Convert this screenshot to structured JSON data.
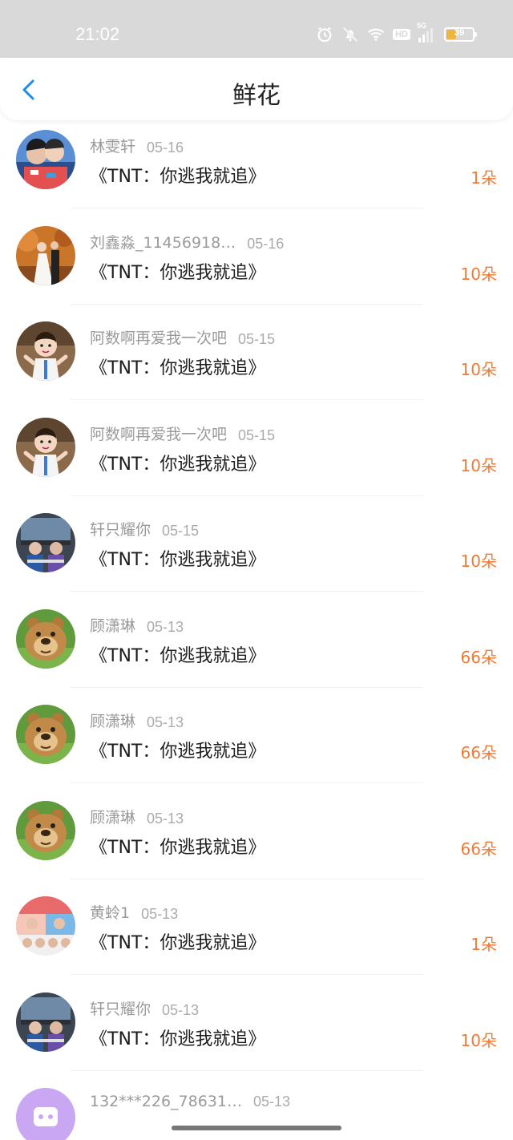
{
  "status_bar": {
    "time": "21:02",
    "network": "5G",
    "hd": "HD",
    "battery": "39",
    "battery_level": 0.39,
    "icons": [
      "alarm-icon",
      "mute-icon",
      "wifi-icon",
      "hd-icon",
      "signal-icon",
      "battery-icon"
    ]
  },
  "header": {
    "title": "鲜花",
    "back_icon": "chevron-left-icon",
    "accent": "#1a8cf0"
  },
  "colors": {
    "amount": "#f07a33",
    "name": "#9a9a9a",
    "book": "#1d1d1d"
  },
  "items": [
    {
      "name": "林雯轩",
      "date": "05-16",
      "book": "《TNT：你逃我就追》",
      "amount": "1朵",
      "avatar": "couple-photo"
    },
    {
      "name": "刘鑫淼_11456918…",
      "date": "05-16",
      "book": "《TNT：你逃我就追》",
      "amount": "10朵",
      "avatar": "wedding-photo"
    },
    {
      "name": "阿数啊再爱我一次吧",
      "date": "05-15",
      "book": "《TNT：你逃我就追》",
      "amount": "10朵",
      "avatar": "baby-photo"
    },
    {
      "name": "阿数啊再爱我一次吧",
      "date": "05-15",
      "book": "《TNT：你逃我就追》",
      "amount": "10朵",
      "avatar": "baby-photo"
    },
    {
      "name": "轩只耀你",
      "date": "05-15",
      "book": "《TNT：你逃我就追》",
      "amount": "10朵",
      "avatar": "group-photo"
    },
    {
      "name": "顾潇琳",
      "date": "05-13",
      "book": "《TNT：你逃我就追》",
      "amount": "66朵",
      "avatar": "bear-cartoon"
    },
    {
      "name": "顾潇琳",
      "date": "05-13",
      "book": "《TNT：你逃我就追》",
      "amount": "66朵",
      "avatar": "bear-cartoon"
    },
    {
      "name": "顾潇琳",
      "date": "05-13",
      "book": "《TNT：你逃我就追》",
      "amount": "66朵",
      "avatar": "bear-cartoon"
    },
    {
      "name": "黄蛉1",
      "date": "05-13",
      "book": "《TNT：你逃我就追》",
      "amount": "1朵",
      "avatar": "collage-photo"
    },
    {
      "name": "轩只耀你",
      "date": "05-13",
      "book": "《TNT：你逃我就追》",
      "amount": "10朵",
      "avatar": "group-photo"
    },
    {
      "name": "132***226_78631…",
      "date": "05-13",
      "book": "",
      "amount": "",
      "avatar": "purple-default"
    }
  ]
}
